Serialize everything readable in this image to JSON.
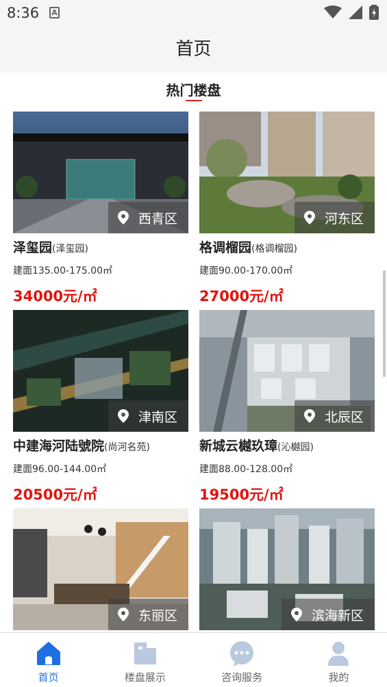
{
  "status_bar": {
    "time": "8:36",
    "notification_glyph": "A"
  },
  "app_bar": {
    "title": "首页"
  },
  "section": {
    "title": "热门楼盘"
  },
  "listings": [
    {
      "name": "泽玺园",
      "alias": "(泽玺园)",
      "district": "西青区",
      "area": "建面135.00-175.00㎡",
      "price": "34000元/㎡"
    },
    {
      "name": "格调榴园",
      "alias": "(格调榴园)",
      "district": "河东区",
      "area": "建面90.00-170.00㎡",
      "price": "27000元/㎡"
    },
    {
      "name": "中建海河陆號院",
      "alias": "(尚河名苑)",
      "district": "津南区",
      "area": "建面96.00-144.00㎡",
      "price": "20500元/㎡"
    },
    {
      "name": "新城云樾玖璋",
      "alias": "(沁樾园)",
      "district": "北辰区",
      "area": "建面88.00-128.00㎡",
      "price": "19500元/㎡"
    },
    {
      "name": "",
      "alias": "",
      "district": "东丽区",
      "area": "",
      "price": ""
    },
    {
      "name": "",
      "alias": "",
      "district": "滨海新区",
      "area": "",
      "price": ""
    }
  ],
  "tabs": [
    {
      "label": "首页",
      "icon": "home-icon",
      "active": true
    },
    {
      "label": "楼盘展示",
      "icon": "building-icon",
      "active": false
    },
    {
      "label": "咨询服务",
      "icon": "chat-icon",
      "active": false
    },
    {
      "label": "我的",
      "icon": "user-icon",
      "active": false
    }
  ],
  "colors": {
    "accent": "#1f6fe0",
    "price": "#e0140f",
    "inactive_tab": "#b9c9df"
  }
}
